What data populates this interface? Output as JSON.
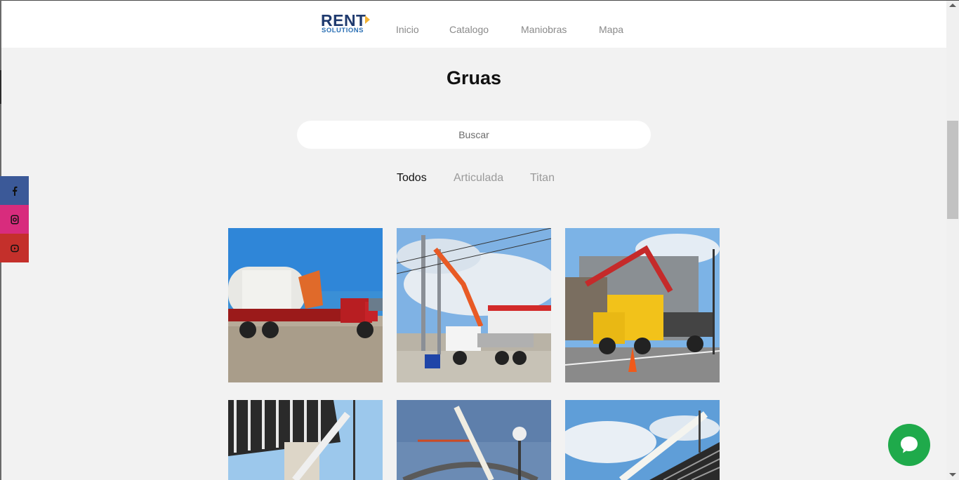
{
  "header": {
    "logo": {
      "word": "RENT",
      "sub": "SOLUTIONS"
    },
    "nav": [
      {
        "label": "Inicio"
      },
      {
        "label": "Catalogo"
      },
      {
        "label": "Maniobras"
      },
      {
        "label": "Mapa"
      }
    ]
  },
  "page": {
    "title": "Gruas"
  },
  "search": {
    "placeholder": "Buscar",
    "value": ""
  },
  "filters": [
    {
      "label": "Todos",
      "active": true
    },
    {
      "label": "Articulada",
      "active": false
    },
    {
      "label": "Titan",
      "active": false
    }
  ],
  "social": [
    {
      "icon": "facebook-icon",
      "color": "#3b5998"
    },
    {
      "icon": "instagram-icon",
      "color": "#d82c7d"
    },
    {
      "icon": "youtube-icon",
      "color": "#c4302b"
    }
  ],
  "gallery": [
    {
      "icon": "photo-crane-truck-tank"
    },
    {
      "icon": "photo-crane-truck-powerlines"
    },
    {
      "icon": "photo-yellow-crane-truck"
    },
    {
      "icon": "photo-crane-pergola"
    },
    {
      "icon": "photo-crane-arch"
    },
    {
      "icon": "photo-crane-roof"
    }
  ],
  "chat": {
    "icon": "chat-bubble-icon",
    "color": "#1faa4b"
  },
  "colors": {
    "background": "#f2f2f2",
    "header": "#ffffff",
    "brand_blue": "#1f3a6e",
    "brand_accent": "#f2b233"
  }
}
